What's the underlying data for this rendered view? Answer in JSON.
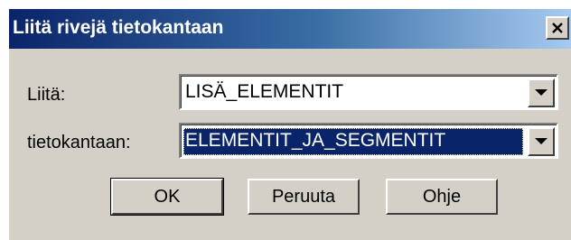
{
  "dialog": {
    "title": "Liitä rivejä tietokantaan",
    "close_symbol": "X"
  },
  "fields": [
    {
      "label": "Liitä:",
      "value": "LISÄ_ELEMENTIT",
      "icon": "chevron-down-icon"
    },
    {
      "label": "tietokantaan:",
      "value": "ELEMENTIT_JA_SEGMENTIT",
      "icon": "chevron-down-icon"
    }
  ],
  "buttons": {
    "ok": "OK",
    "cancel": "Peruuta",
    "help": "Ohje"
  },
  "colors": {
    "titlebar_start": "#0a246a",
    "titlebar_end": "#a6caf0",
    "face": "#d4d0c8",
    "selection": "#0a246a"
  }
}
